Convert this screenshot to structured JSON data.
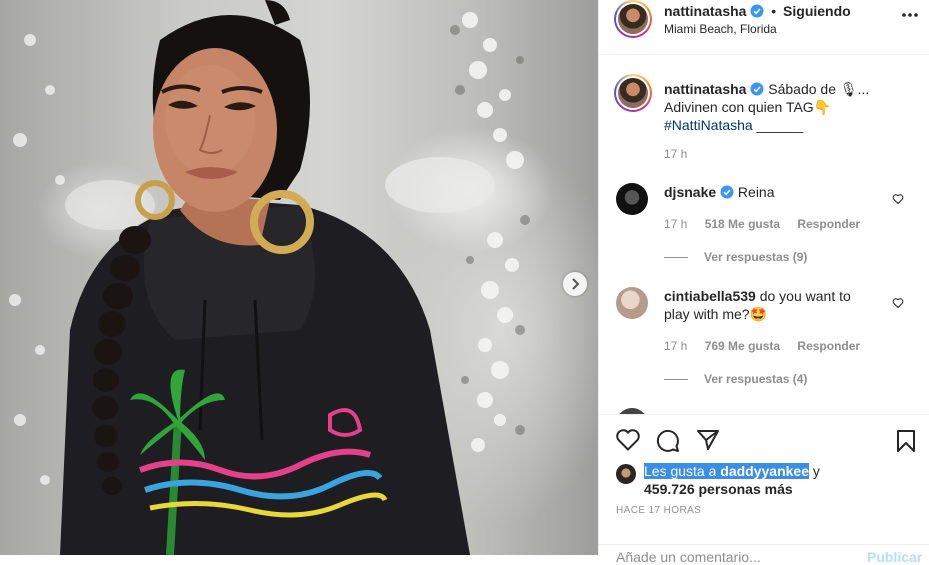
{
  "post": {
    "photo_alt": "Woman in black hoodie with large hoop earrings",
    "next_icon": "chevron-right-icon"
  },
  "header": {
    "username": "nattinatasha",
    "separator": "•",
    "follow_status": "Siguiendo",
    "location": "Miami Beach, Florida",
    "more_icon": "more-horizontal-icon"
  },
  "caption": {
    "username": "nattinatasha",
    "line1": "Sábado de 🎙...",
    "line2": "Adivinen con quien TAG👇",
    "hashtag": "#NattiNatasha",
    "trailing": "______",
    "time": "17 h"
  },
  "comments": [
    {
      "username": "djsnake",
      "verified": true,
      "text": "Reina",
      "time": "17 h",
      "likes": "518 Me gusta",
      "reply": "Responder",
      "view_replies": "Ver respuestas (9)"
    },
    {
      "username": "cintiabella539",
      "verified": false,
      "text": "do you want to play with me?🤩",
      "time": "17 h",
      "likes": "769 Me gusta",
      "reply": "Responder",
      "view_replies": "Ver respuestas (4)"
    }
  ],
  "likes": {
    "prefix": "Les gusta a",
    "user": "daddyyankee",
    "conj": "y",
    "count": "459.726 personas más"
  },
  "timestamp": "HACE 17 HORAS",
  "add_comment": {
    "placeholder": "Añade un comentario...",
    "publish": "Publicar"
  },
  "colors": {
    "verified": "#3897f0",
    "link": "#00376b",
    "muted": "#8e8e8e",
    "selection": "#3a8ee6"
  }
}
